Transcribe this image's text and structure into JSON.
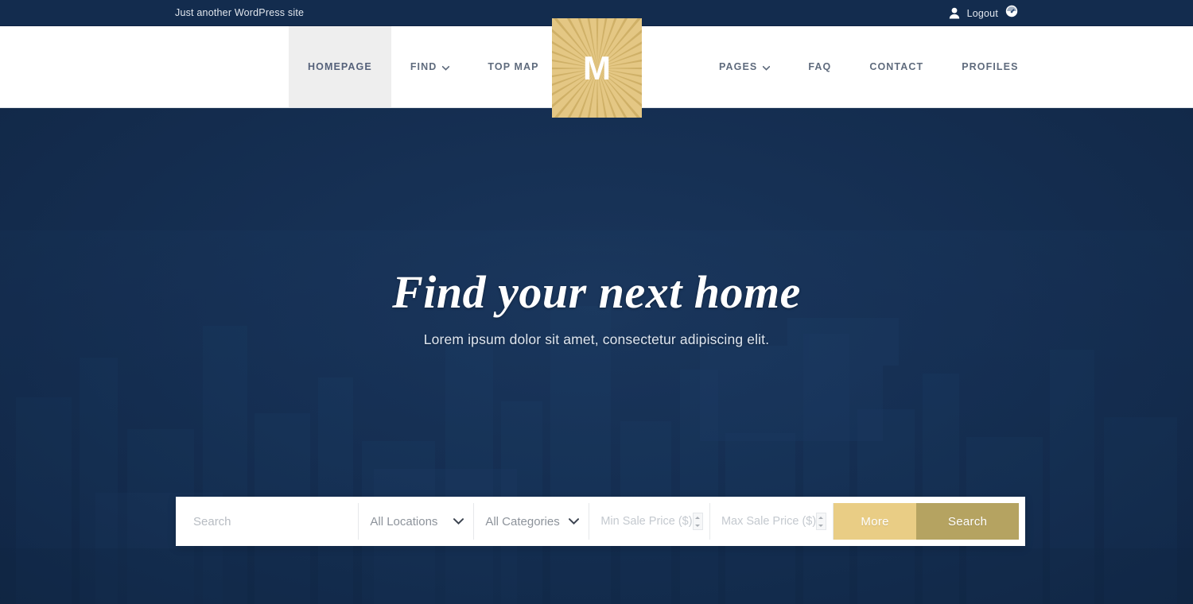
{
  "topbar": {
    "tagline": "Just another WordPress site",
    "user_icon": "user-icon",
    "logout_label": "Logout",
    "dashboard_icon": "dashboard-gauge-icon"
  },
  "logo": {
    "letter": "M",
    "icon": "sunburst-logo-icon"
  },
  "nav": {
    "left": [
      {
        "label": "HOMEPAGE",
        "active": true,
        "has_dropdown": false
      },
      {
        "label": "FIND",
        "active": false,
        "has_dropdown": true
      },
      {
        "label": "TOP MAP",
        "active": false,
        "has_dropdown": false
      }
    ],
    "right": [
      {
        "label": "PAGES",
        "active": false,
        "has_dropdown": true
      },
      {
        "label": "FAQ",
        "active": false,
        "has_dropdown": false
      },
      {
        "label": "CONTACT",
        "active": false,
        "has_dropdown": false
      },
      {
        "label": "PROFILES",
        "active": false,
        "has_dropdown": false
      }
    ]
  },
  "hero": {
    "title": "Find your next home",
    "subtitle": "Lorem ipsum dolor sit amet, consectetur adipiscing elit."
  },
  "search": {
    "keyword_placeholder": "Search",
    "keyword_value": "",
    "location_selected": "All Locations",
    "category_selected": "All Categories",
    "min_price_placeholder": "Min Sale Price  ($)",
    "max_price_placeholder": "Max Sale Price  ($)",
    "min_price_value": "",
    "max_price_value": "",
    "more_label": "More",
    "search_label": "Search",
    "chevron_icon": "chevron-down-icon",
    "spinner_icon": "number-spinner-icon"
  },
  "colors": {
    "topbar_navy": "#132c4e",
    "hero_navy": "#163054",
    "gold_light": "#e9cd85",
    "gold_dark": "#b5a361",
    "logo_gold": "#e4c784",
    "nav_text": "#5f6b7d",
    "active_tab_bg": "#eeeeee"
  }
}
